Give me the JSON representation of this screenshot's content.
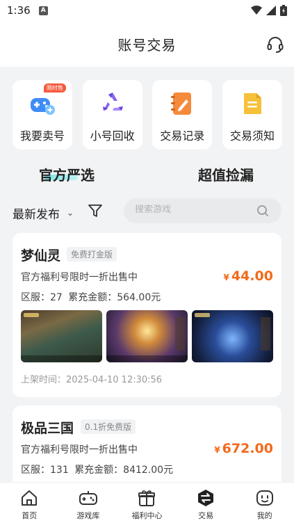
{
  "status_bar": {
    "time": "1:36",
    "notification_badge": "A"
  },
  "header": {
    "title": "账号交易",
    "support_icon": "headset-icon"
  },
  "quick_actions": [
    {
      "label": "我要卖号",
      "icon": "gamepad-plus-icon",
      "badge": "限时售",
      "color": "#3f8cf7"
    },
    {
      "label": "小号回收",
      "icon": "recycle-icon",
      "color": "#8a63f2"
    },
    {
      "label": "交易记录",
      "icon": "edit-notebook-icon",
      "color": "#f58a3c"
    },
    {
      "label": "交易须知",
      "icon": "document-icon",
      "color": "#f7c03a"
    }
  ],
  "segment_tabs": {
    "active": "官方严选",
    "other": "超值捡漏"
  },
  "filter": {
    "sort_label": "最新发布",
    "sort_chevron": "⌄",
    "search_placeholder": "搜索游戏"
  },
  "listings": [
    {
      "name": "梦仙灵",
      "tag": "免费打金版",
      "description": "官方福利号限时一折出售中",
      "currency": "¥",
      "price": "44.00",
      "server": "区服：27   累充金额：564.00元",
      "listed_time": "上架时间：2025-04-10 12:30:56"
    },
    {
      "name": "极品三国",
      "tag": "0.1折免费版",
      "description": "官方福利号限时一折出售中",
      "currency": "¥",
      "price": "672.00",
      "server": "区服：131   累充金额：8412.00元"
    }
  ],
  "bottom_nav": [
    {
      "label": "首页",
      "icon": "home-icon"
    },
    {
      "label": "游戏库",
      "icon": "gamepad-icon"
    },
    {
      "label": "福利中心",
      "icon": "gift-icon"
    },
    {
      "label": "交易",
      "icon": "trade-exchange-icon",
      "active": true
    },
    {
      "label": "我的",
      "icon": "profile-face-icon"
    }
  ],
  "colors": {
    "price": "#f26a1b",
    "accent_underline": "#7be3e8",
    "background": "#f2f3f5"
  }
}
